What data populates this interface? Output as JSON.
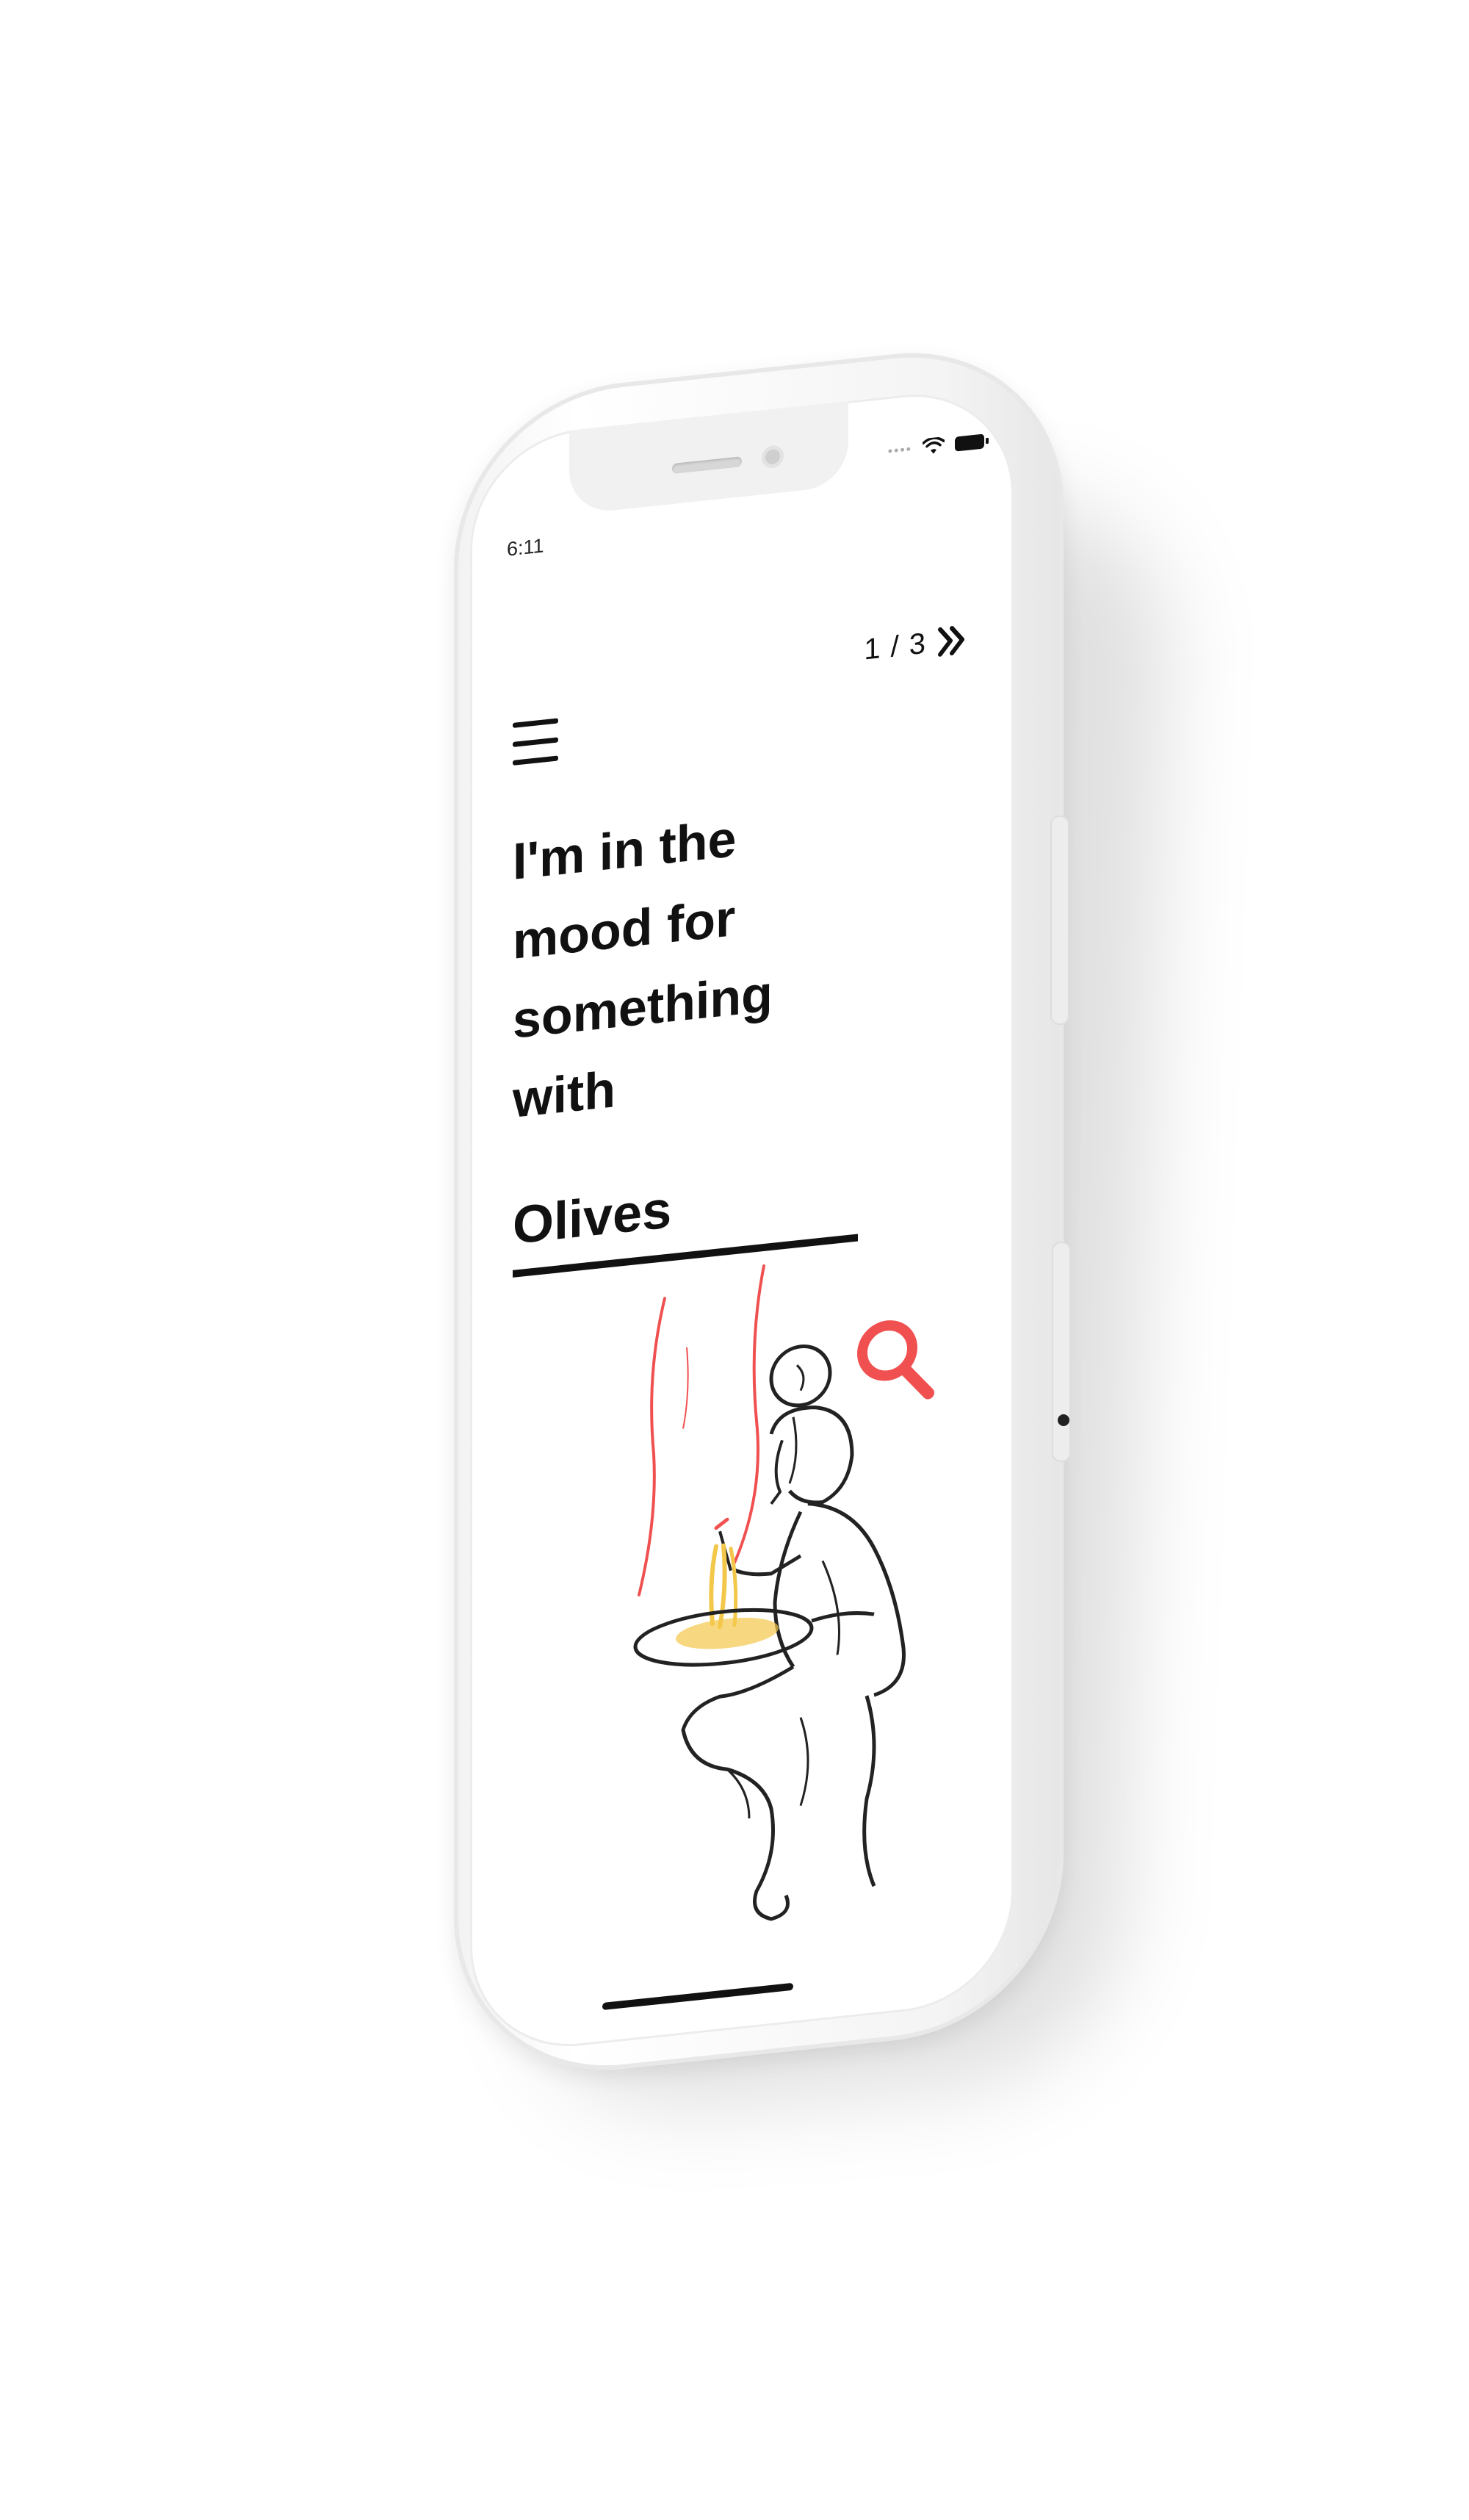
{
  "status_bar": {
    "time": "6:11"
  },
  "header": {
    "pager_current": "1",
    "pager_separator": "/",
    "pager_total": "3",
    "next_icon": "double-chevron-right-icon",
    "menu_icon": "hamburger-menu-icon"
  },
  "main": {
    "headline": "I'm in the\nmood for\nsomething\nwith",
    "search_value": "Olives",
    "search_icon": "search-icon"
  },
  "colors": {
    "accent": "#f05050",
    "text": "#111111",
    "pasta": "#f3c84a"
  }
}
